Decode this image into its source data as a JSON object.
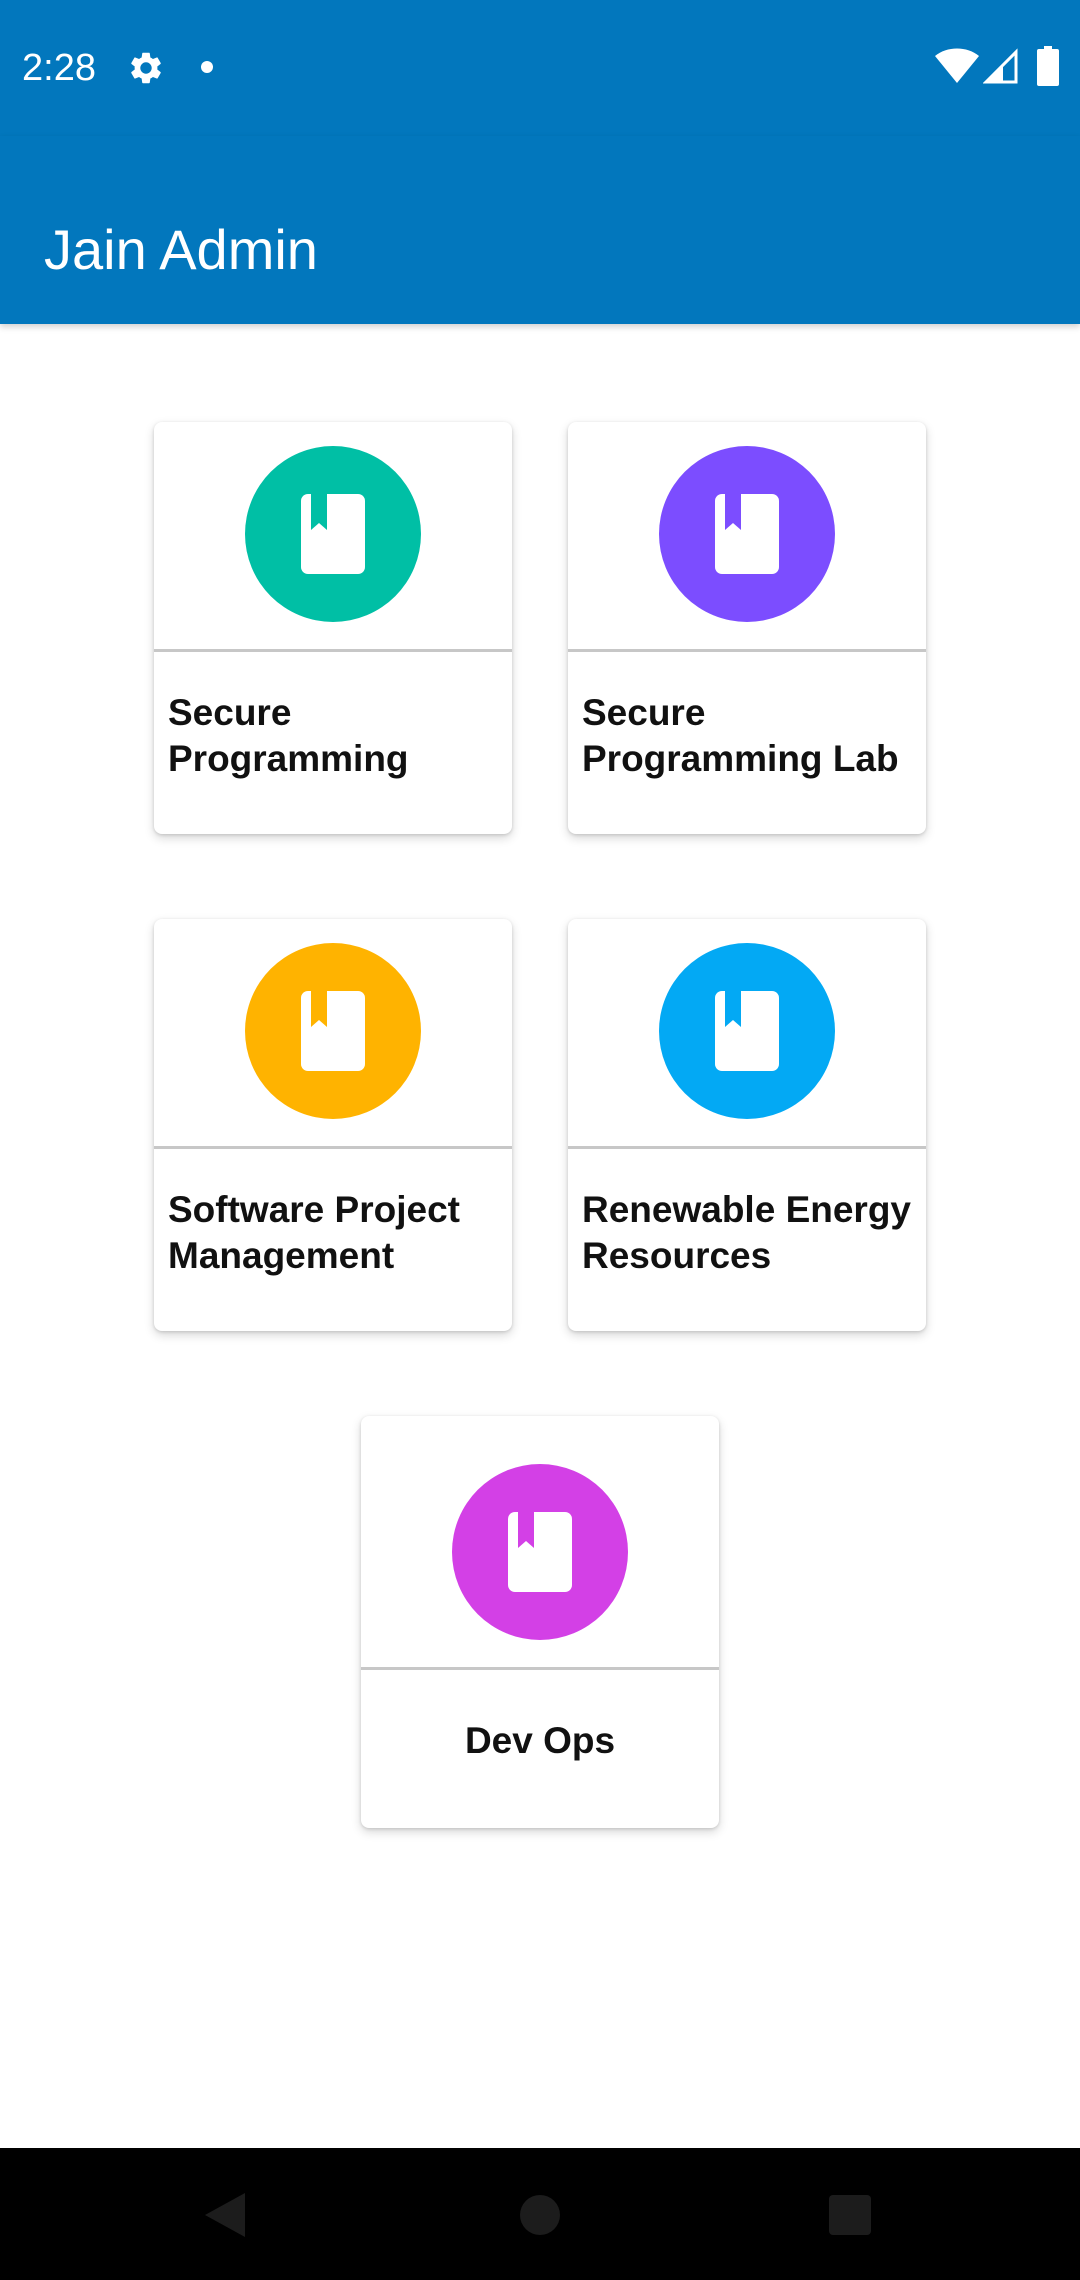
{
  "status_bar": {
    "time": "2:28",
    "icons": [
      "settings-icon",
      "notification-dot",
      "wifi-icon",
      "cell-signal-icon",
      "battery-icon"
    ]
  },
  "app_bar": {
    "title": "Jain Admin",
    "color": "#0277bd"
  },
  "courses": [
    {
      "title": "Secure Programming",
      "icon": "book-icon",
      "color": "#00bfa5"
    },
    {
      "title": "Secure Programming Lab",
      "icon": "book-icon",
      "color": "#7c4dff"
    },
    {
      "title": "Software Project Management",
      "icon": "book-icon",
      "color": "#ffb300"
    },
    {
      "title": "Renewable Energy Resources",
      "icon": "book-icon",
      "color": "#03a9f4"
    },
    {
      "title": "Dev Ops",
      "icon": "book-icon",
      "color": "#d340e6"
    }
  ],
  "nav_bar": {
    "icons": [
      "back-icon",
      "home-icon",
      "recents-icon"
    ]
  }
}
